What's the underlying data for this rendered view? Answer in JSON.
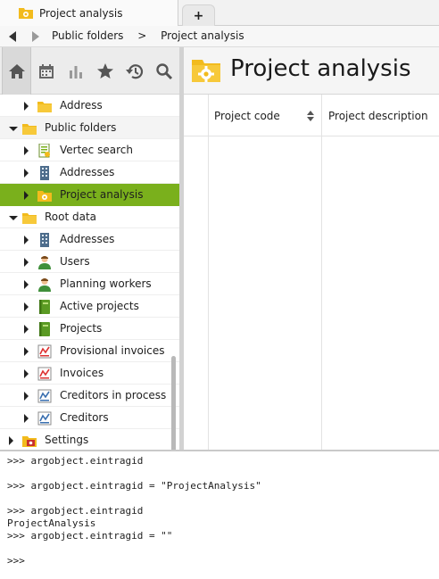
{
  "tab": {
    "title": "Project analysis",
    "new_tab_label": "+"
  },
  "breadcrumb": [
    "Public folders",
    ">",
    "Project analysis"
  ],
  "sidebar_tools": [
    "home-icon",
    "calendar-icon",
    "bar-chart-icon",
    "star-icon",
    "history-icon",
    "search-icon"
  ],
  "tree": [
    {
      "label": "Address",
      "icon": "folder-icon",
      "indent": 1,
      "expander": "closed"
    },
    {
      "label": "Public folders",
      "icon": "folder-icon",
      "indent": 0,
      "expander": "open",
      "group": true
    },
    {
      "label": "Vertec search",
      "icon": "document-icon",
      "indent": 1,
      "expander": "closed"
    },
    {
      "label": "Addresses",
      "icon": "building-icon",
      "indent": 1,
      "expander": "closed"
    },
    {
      "label": "Project analysis",
      "icon": "project-analysis-icon",
      "indent": 1,
      "expander": "closed",
      "selected": true
    },
    {
      "label": "Root data",
      "icon": "folder-icon",
      "indent": 0,
      "expander": "open"
    },
    {
      "label": "Addresses",
      "icon": "building-icon",
      "indent": 1,
      "expander": "closed"
    },
    {
      "label": "Users",
      "icon": "user-icon",
      "indent": 1,
      "expander": "closed"
    },
    {
      "label": "Planning workers",
      "icon": "user-icon",
      "indent": 1,
      "expander": "closed"
    },
    {
      "label": "Active projects",
      "icon": "project-book-icon",
      "indent": 1,
      "expander": "closed"
    },
    {
      "label": "Projects",
      "icon": "project-book-icon",
      "indent": 1,
      "expander": "closed"
    },
    {
      "label": "Provisional invoices",
      "icon": "invoice-icon",
      "indent": 1,
      "expander": "closed"
    },
    {
      "label": "Invoices",
      "icon": "invoice-icon",
      "indent": 1,
      "expander": "closed"
    },
    {
      "label": "Creditors in process",
      "icon": "creditor-icon",
      "indent": 1,
      "expander": "closed"
    },
    {
      "label": "Creditors",
      "icon": "creditor-icon",
      "indent": 1,
      "expander": "closed"
    },
    {
      "label": "Settings",
      "icon": "settings-folder-icon",
      "indent": 0,
      "expander": "closed"
    }
  ],
  "main": {
    "title": "Project analysis",
    "columns": [
      "Project code",
      "Project description"
    ]
  },
  "console": [
    ">>> argobject.eintragid",
    "",
    ">>> argobject.eintragid = \"ProjectAnalysis\"",
    "",
    ">>> argobject.eintragid",
    "ProjectAnalysis",
    ">>> argobject.eintragid = \"\"",
    "",
    ">>>"
  ],
  "colors": {
    "selection": "#7ab01c",
    "folder": "#f2bb1d"
  }
}
